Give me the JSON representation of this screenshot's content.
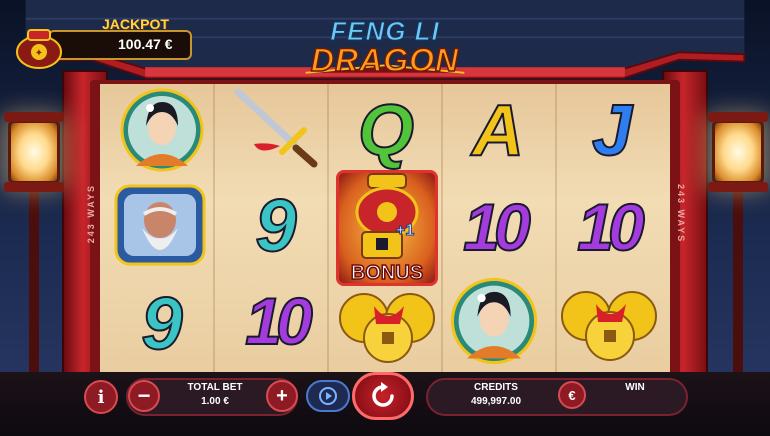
{
  "jackpot": {
    "label": "JACKPOT",
    "value": "100.47 €"
  },
  "title": {
    "line1": "FENG LI",
    "line2": "DRAGON"
  },
  "side_text": {
    "left": "243 WAYS",
    "right": "243 WAYS"
  },
  "reels": {
    "r1c3": "Q",
    "r1c4": "A",
    "r1c5": "J",
    "r2c2": "9",
    "r2c4": "10",
    "r2c5": "10",
    "r3c1": "9",
    "r3c2": "10"
  },
  "bonus": {
    "label": "BONUS",
    "plus": "+1"
  },
  "controls": {
    "info_label": "i",
    "minus_label": "−",
    "plus_label": "+",
    "total_bet_label": "TOTAL BET",
    "total_bet_value": "1.00 €",
    "credits_label": "CREDITS",
    "credits_value": "499,997.00",
    "currency_label": "€",
    "win_label": "WIN"
  },
  "icons": [
    "jackpot-pot-icon",
    "portrait-woman-icon",
    "portrait-old-man-icon",
    "sword-icon",
    "coin-stack-icon",
    "autoplay-icon",
    "spin-icon"
  ],
  "colors": {
    "accent_red": "#c8252b",
    "gold": "#ffd54a",
    "bet_panel": "#2b1a24"
  }
}
